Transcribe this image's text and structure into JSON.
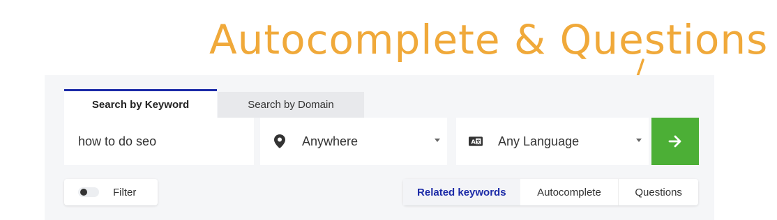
{
  "annotation": {
    "title": "Autocomplete & Questions",
    "color": "#f0a93a"
  },
  "tabs": {
    "keyword": "Search by Keyword",
    "domain": "Search by Domain",
    "active_color": "#1b2aa7"
  },
  "search": {
    "keyword_value": "how to do seo",
    "location": {
      "value": "Anywhere",
      "icon": "location-pin-icon"
    },
    "language": {
      "value": "Any Language",
      "icon": "translate-icon"
    },
    "go_button": {
      "icon": "arrow-right-icon",
      "color": "#4caf36"
    }
  },
  "filter": {
    "label": "Filter",
    "enabled": false
  },
  "result_tabs": {
    "related": "Related keywords",
    "autocomplete": "Autocomplete",
    "questions": "Questions",
    "active": "Related keywords"
  }
}
